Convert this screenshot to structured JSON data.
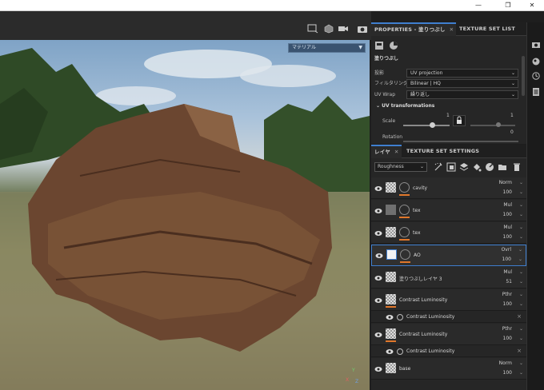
{
  "window": {
    "controls": {
      "minimize": "—",
      "maximize": "❐",
      "close": "✕"
    }
  },
  "viewport": {
    "view_mode_select": "マテリアル",
    "axis_labels": {
      "y": "Y",
      "x": "X",
      "z": "Z"
    }
  },
  "properties_panel": {
    "tabs": [
      {
        "label": "PROPERTIES - 塗りつぶし",
        "active": true
      },
      {
        "label": "TEXTURE SET LIST",
        "active": false
      }
    ],
    "section_title": "塗りつぶし",
    "rows": [
      {
        "label": "投影",
        "value": "UV projection"
      },
      {
        "label": "フィルタリング",
        "value": "Bilinear | HQ"
      },
      {
        "label": "UV Wrap",
        "value": "繰り返し"
      }
    ],
    "uv_section": "UV transformations",
    "scale_label": "Scale",
    "scale_value": "1",
    "scale_value_right": "1",
    "scale_value_small": "0",
    "rotation_label": "Rotation"
  },
  "layers_panel": {
    "tabs": [
      {
        "label": "レイヤ",
        "active": true
      },
      {
        "label": "TEXTURE SET SETTINGS",
        "active": false
      }
    ],
    "channel_select": "Roughness",
    "layers": [
      {
        "name": "cavity",
        "blend": "Norm",
        "opacity": "100",
        "thumb": "checker",
        "selected": false
      },
      {
        "name": "tex",
        "blend": "Mul",
        "opacity": "100",
        "thumb": "grey",
        "selected": false
      },
      {
        "name": "tex",
        "blend": "Mul",
        "opacity": "100",
        "thumb": "checker",
        "selected": false
      },
      {
        "name": "AO",
        "blend": "Ovrl",
        "opacity": "100",
        "thumb": "white",
        "selected": true
      },
      {
        "name": "塗りつぶしレイヤ 3",
        "blend": "Mul",
        "opacity": "51",
        "thumb": "checker",
        "selected": false
      },
      {
        "name": "Contrast Luminosity",
        "blend": "Pthr",
        "opacity": "100",
        "thumb": "folder",
        "selected": false
      },
      {
        "sub": true,
        "name": "Contrast Luminosity"
      },
      {
        "name": "Contrast Luminosity",
        "blend": "Pthr",
        "opacity": "100",
        "thumb": "folder",
        "selected": false
      },
      {
        "sub": true,
        "name": "Contrast Luminosity"
      },
      {
        "name": "base",
        "blend": "Norm",
        "opacity": "100",
        "thumb": "checker",
        "selected": false
      }
    ]
  },
  "colors": {
    "accent": "#3f7fd0",
    "mask_bar": "#e0772b"
  }
}
